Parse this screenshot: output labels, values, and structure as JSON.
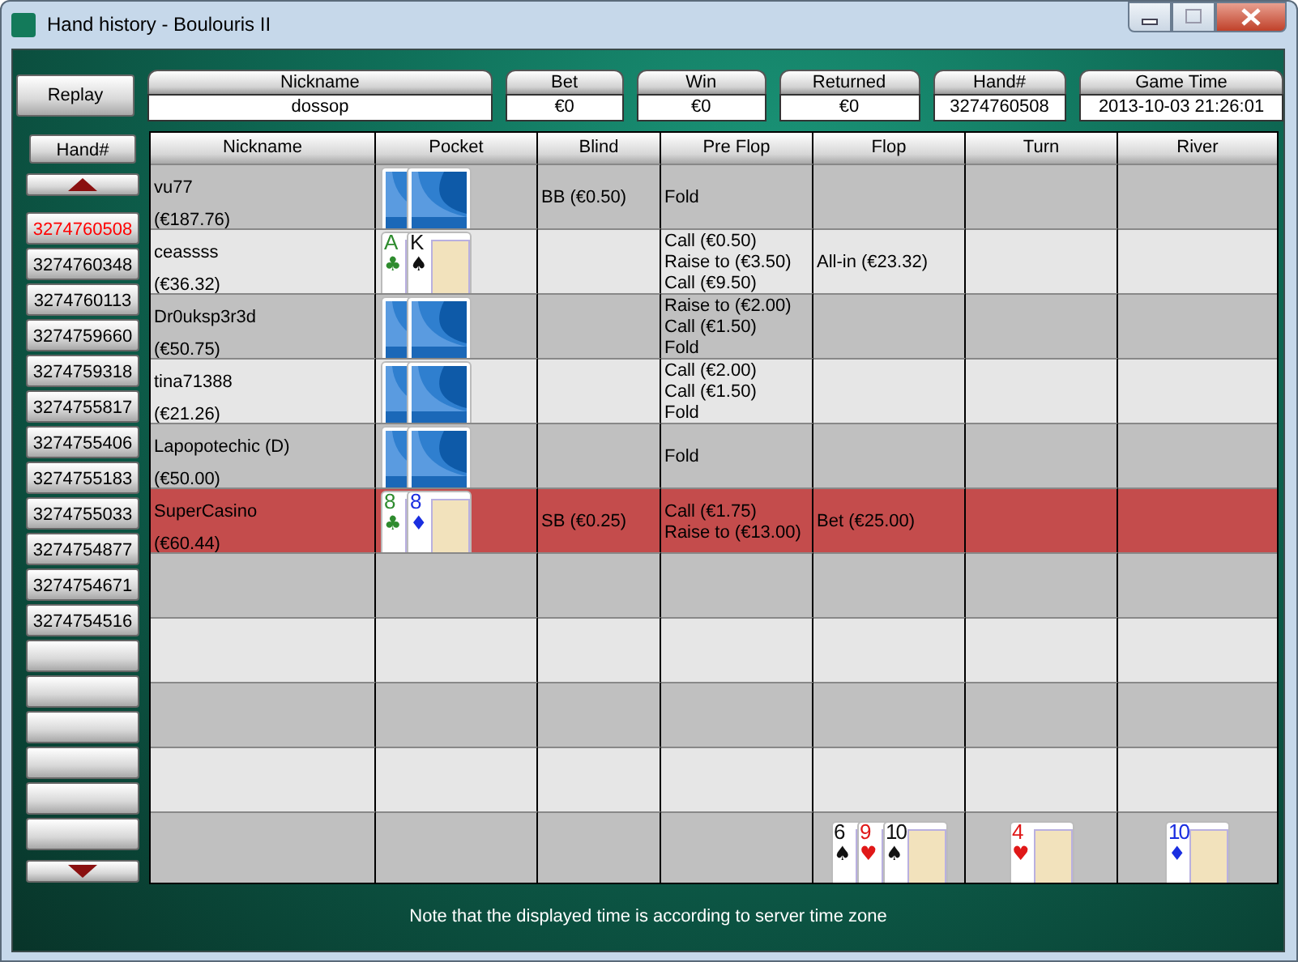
{
  "window": {
    "title": "Hand history - Boulouris II"
  },
  "replay_button": "Replay",
  "summary": [
    {
      "label": "Nickname",
      "value": "dossop"
    },
    {
      "label": "Bet",
      "value": "€0"
    },
    {
      "label": "Win",
      "value": "€0"
    },
    {
      "label": "Returned",
      "value": "€0"
    },
    {
      "label": "Hand#",
      "value": "3274760508"
    },
    {
      "label": "Game Time",
      "value": "2013-10-03 21:26:01"
    }
  ],
  "hand_list": {
    "title": "Hand#",
    "items": [
      {
        "label": "3274760508",
        "selected": true
      },
      {
        "label": "3274760348",
        "selected": false
      },
      {
        "label": "3274760113",
        "selected": false
      },
      {
        "label": "3274759660",
        "selected": false
      },
      {
        "label": "3274759318",
        "selected": false
      },
      {
        "label": "3274755817",
        "selected": false
      },
      {
        "label": "3274755406",
        "selected": false
      },
      {
        "label": "3274755183",
        "selected": false
      },
      {
        "label": "3274755033",
        "selected": false
      },
      {
        "label": "3274754877",
        "selected": false
      },
      {
        "label": "3274754671",
        "selected": false
      },
      {
        "label": "3274754516",
        "selected": false
      }
    ]
  },
  "table": {
    "columns": [
      "Nickname",
      "Pocket",
      "Blind",
      "Pre Flop",
      "Flop",
      "Turn",
      "River"
    ],
    "rows": [
      {
        "nickname": "vu77",
        "stack": "(€187.76)",
        "selected": false,
        "pocket": [
          {
            "kind": "back"
          },
          {
            "kind": "back"
          }
        ],
        "blind": "BB (€0.50)",
        "pre_flop": [
          "Fold"
        ],
        "flop": []
      },
      {
        "nickname": "ceassss",
        "stack": "(€36.32)",
        "selected": false,
        "pocket": [
          {
            "kind": "face",
            "rank": "A",
            "suit": "♣",
            "color": "#2e8b2e"
          },
          {
            "kind": "face",
            "rank": "K",
            "suit": "♠",
            "color": "#111111"
          }
        ],
        "pre_flop": [
          "Call (€0.50)",
          "Raise to (€3.50)",
          "Call (€9.50)"
        ],
        "flop": [
          "All-in (€23.32)"
        ]
      },
      {
        "nickname": "Dr0uksp3r3d",
        "stack": "(€50.75)",
        "selected": false,
        "pocket": [
          {
            "kind": "back"
          },
          {
            "kind": "back"
          }
        ],
        "pre_flop": [
          "Raise to (€2.00)",
          "Call (€1.50)",
          "Fold"
        ],
        "flop": []
      },
      {
        "nickname": "tina71388",
        "stack": "(€21.26)",
        "selected": false,
        "pocket": [
          {
            "kind": "back"
          },
          {
            "kind": "back"
          }
        ],
        "pre_flop": [
          "Call (€2.00)",
          "Call (€1.50)",
          "Fold"
        ],
        "flop": []
      },
      {
        "nickname": "Lapopotechic (D)",
        "stack": "(€50.00)",
        "selected": false,
        "pocket": [
          {
            "kind": "back"
          },
          {
            "kind": "back"
          }
        ],
        "pre_flop": [
          "Fold"
        ],
        "flop": []
      },
      {
        "nickname": "SuperCasino",
        "stack": "(€60.44)",
        "selected": true,
        "pocket": [
          {
            "kind": "face",
            "rank": "8",
            "suit": "♣",
            "color": "#2e8b2e"
          },
          {
            "kind": "face",
            "rank": "8",
            "suit": "♦",
            "color": "#1a2ee0"
          }
        ],
        "blind": "SB (€0.25)",
        "pre_flop": [
          "Call (€1.75)",
          "Raise to (€13.00)"
        ],
        "flop": [
          "Bet (€25.00)"
        ]
      }
    ],
    "board": {
      "flop": [
        {
          "kind": "face",
          "rank": "6",
          "suit": "♠",
          "color": "#111111"
        },
        {
          "kind": "face",
          "rank": "9",
          "suit": "♥",
          "color": "#e01818"
        },
        {
          "kind": "face",
          "rank": "10",
          "suit": "♠",
          "color": "#111111"
        }
      ],
      "turn": [
        {
          "kind": "face",
          "rank": "4",
          "suit": "♥",
          "color": "#e01818"
        }
      ],
      "river": [
        {
          "kind": "face",
          "rank": "10",
          "suit": "♦",
          "color": "#1a2ee0"
        }
      ]
    }
  },
  "footer_note": "Note that the displayed time is according to server time zone"
}
